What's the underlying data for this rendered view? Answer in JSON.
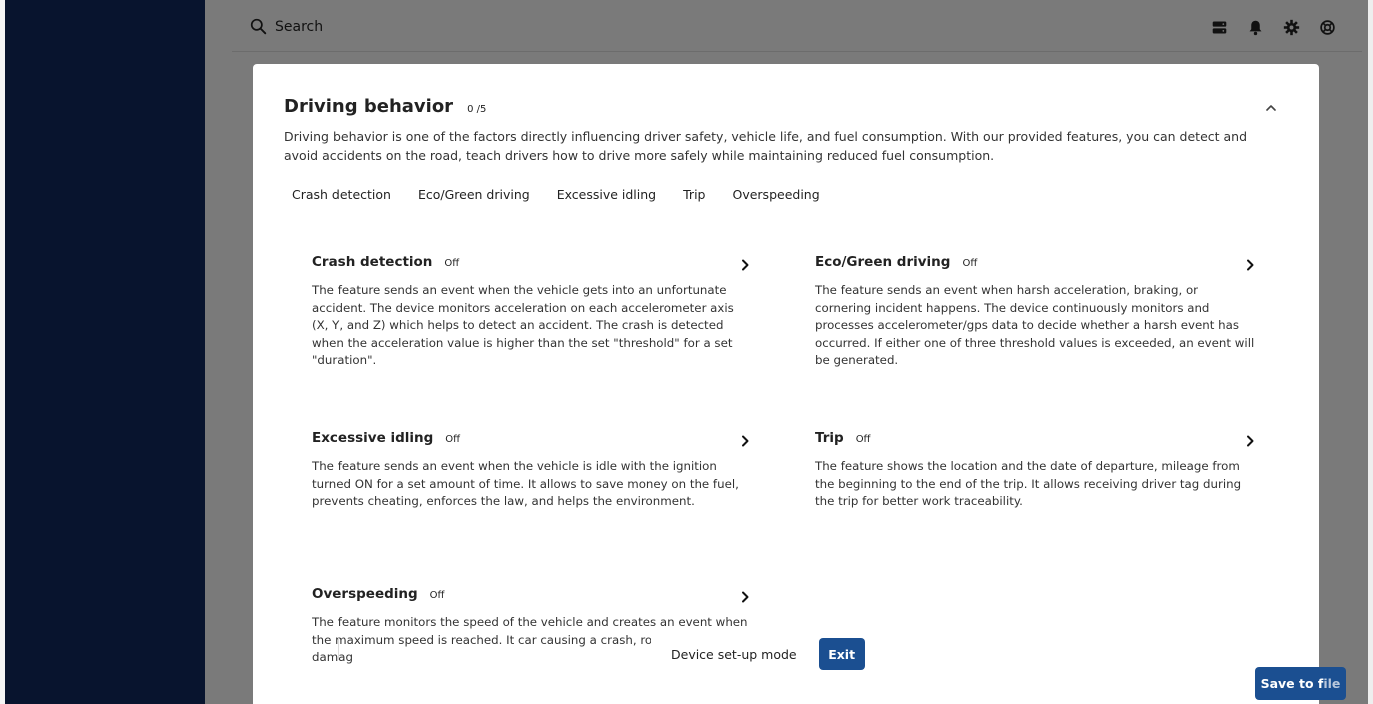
{
  "topbar": {
    "search_label": "Search"
  },
  "panel": {
    "title": "Driving behavior",
    "count": "0 /5",
    "description": "Driving behavior is one of the factors directly influencing driver safety, vehicle life, and fuel consumption. With our provided features, you can detect and avoid accidents on the road, teach drivers how to drive more safely while maintaining reduced fuel consumption."
  },
  "tabs": [
    "Crash detection",
    "Eco/Green driving",
    "Excessive idling",
    "Trip",
    "Overspeeding"
  ],
  "cards": [
    {
      "title": "Crash detection",
      "status": "Off",
      "description": "The feature sends an event when the vehicle gets into an unfortunate accident. The device monitors acceleration on each accelerometer axis (X, Y, and Z) which helps to detect an accident. The crash is detected when the acceleration value is higher than the set \"threshold\" for a set \"duration\"."
    },
    {
      "title": "Eco/Green driving",
      "status": "Off",
      "description": "The feature sends an event when harsh acceleration, braking, or cornering incident happens. The device continuously monitors and processes accelerometer/gps data to decide whether a harsh event has occurred. If either one of three threshold values is exceeded, an event will be generated."
    },
    {
      "title": "Excessive idling",
      "status": "Off",
      "description": "The feature sends an event when the vehicle is idle with the ignition turned ON for a set amount of time. It allows to save money on the fuel, prevents cheating, enforces the law, and helps the environment."
    },
    {
      "title": "Trip",
      "status": "Off",
      "description": "The feature shows the location and the date of departure, mileage from the beginning to the end of the trip. It allows receiving driver tag during the trip for better work traceability."
    },
    {
      "title": "Overspeeding",
      "status": "Off",
      "description": "The feature monitors the speed of the vehicle and creates an event when the maximum speed is reached. It car causing a crash, road infrastructure damag"
    }
  ],
  "setup": {
    "label": "Device set-up mode",
    "exit_label": "Exit"
  },
  "save": {
    "label_visible": "Save to f",
    "label_faded": "ile"
  }
}
